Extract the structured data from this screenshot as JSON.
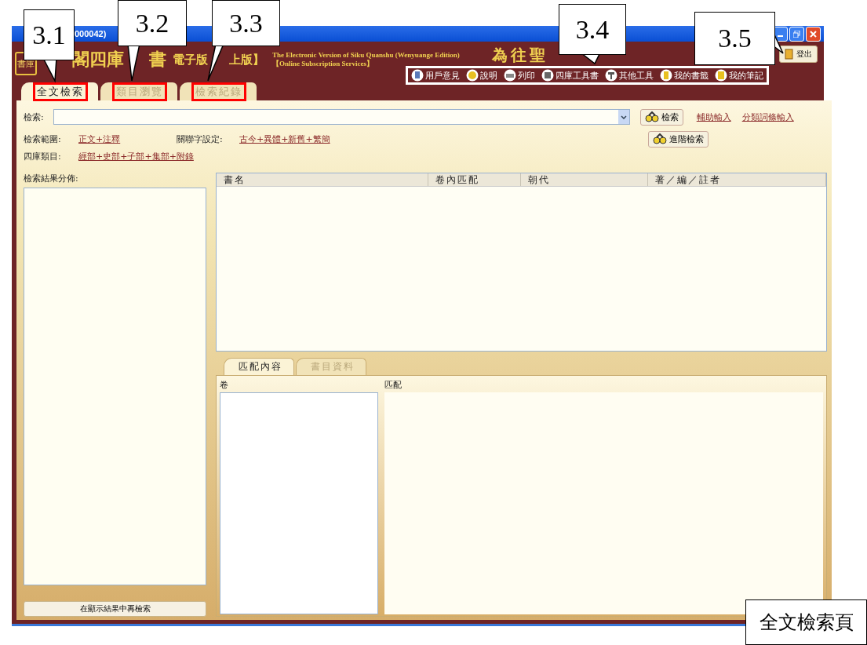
{
  "window": {
    "title": "000042)"
  },
  "banner": {
    "logo_seal": "書庫",
    "title_parts": [
      "閣四庫",
      "書",
      "電子版",
      "上版】"
    ],
    "english_lines": [
      "The Electronic Version of Siku Quanshu (Wenyuange Edition)",
      "【Online Subscription Services】"
    ],
    "motto": "為往聖"
  },
  "logout_button": {
    "label": "登出"
  },
  "toolbar": {
    "outlined": true,
    "items": [
      "用戶意見",
      "說明",
      "列印",
      "四庫工具書",
      "其他工具",
      "我的書籤",
      "我的筆記"
    ]
  },
  "tabs": [
    {
      "label": "全文檢索",
      "selected": true,
      "highlighted": true
    },
    {
      "label": "類目瀏覽",
      "selected": false,
      "highlighted": true
    },
    {
      "label": "檢索紀錄",
      "selected": false,
      "highlighted": true
    }
  ],
  "search": {
    "label": "檢索:",
    "button": "檢索",
    "advanced_button": "進階檢索",
    "links": [
      "輔助輸入",
      "分類詞條輸入"
    ]
  },
  "settings": [
    {
      "label": "檢索範圍:",
      "value": "正文+注釋"
    },
    {
      "label": "關聯字設定:",
      "value": "古今+異體+新舊+繁簡"
    },
    {
      "label": "四庫類目:",
      "value": "經部+史部+子部+集部+附錄"
    }
  ],
  "distribution": {
    "label": "檢索結果分佈:",
    "button": "在顯示結果中再檢索"
  },
  "results_table": {
    "columns": [
      "書名",
      "卷內匹配",
      "朝代",
      "著／編／註者"
    ]
  },
  "detail_tabs": [
    {
      "label": "匹配內容",
      "selected": true
    },
    {
      "label": "書目資料",
      "selected": false
    }
  ],
  "detail": {
    "volume_label": "卷",
    "match_label": "匹配"
  },
  "callouts": [
    "3.1",
    "3.2",
    "3.3",
    "3.4",
    "3.5"
  ],
  "page_caption": "全文檢索頁"
}
